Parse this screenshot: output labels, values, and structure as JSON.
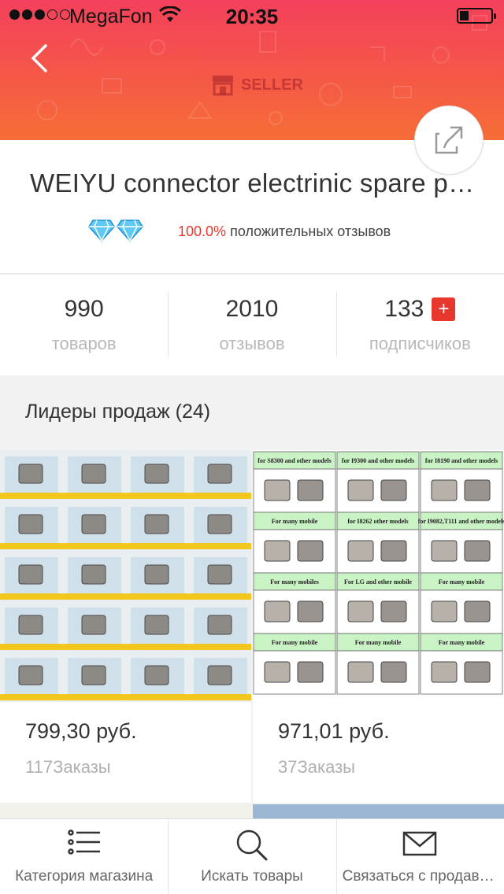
{
  "status_bar": {
    "carrier": "MegaFon",
    "time": "20:35",
    "signal_bars_filled": 3,
    "signal_bars_total": 5,
    "battery_level": 0.3
  },
  "header": {
    "seller_label": "SELLER",
    "back_icon": "chevron-left-icon",
    "share_icon": "share-icon",
    "gradient_colors": [
      "#f4405c",
      "#f66e37"
    ]
  },
  "store": {
    "name": "WEIYU connector electrinic spare parts",
    "diamond_count": 2,
    "positive_pct": "100.0%",
    "positive_label": "положительных отзывов"
  },
  "stats": [
    {
      "value": "990",
      "label": "товаров"
    },
    {
      "value": "2010",
      "label": "отзывов"
    },
    {
      "value": "133",
      "label": "подписчиков",
      "action": "+"
    }
  ],
  "section": {
    "title": "Лидеры продаж (24)"
  },
  "products": [
    {
      "price": "799,30 руб.",
      "orders": "117Заказы"
    },
    {
      "price": "971,01 руб.",
      "orders": "37Заказы"
    }
  ],
  "product_image_text": {
    "p2_row_labels": [
      "for S8300 and other models",
      "for I9300 and other models",
      "for I8190 and other models",
      "For many mobile",
      "for I8262 other models",
      "for I9082,T111 and other models",
      "For many mobiles",
      "For LG and other mobile",
      "For many mobile",
      "For many mobile",
      "For many mobile",
      "For many mobile"
    ]
  },
  "tabbar": [
    {
      "label": "Категория магазина",
      "icon": "list-icon"
    },
    {
      "label": "Искать товары",
      "icon": "search-icon"
    },
    {
      "label": "Связаться с продавцом",
      "icon": "mail-icon"
    }
  ],
  "colors": {
    "accent": "#e8372c",
    "muted_text": "#b8b8b8"
  }
}
